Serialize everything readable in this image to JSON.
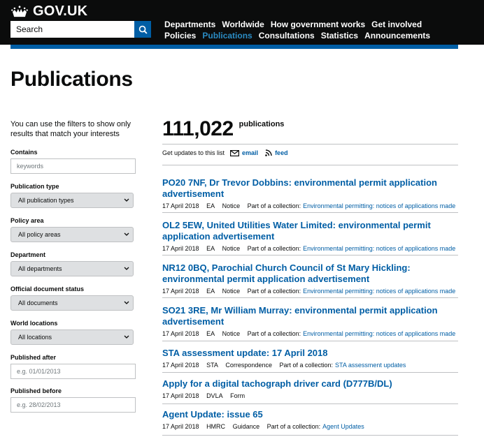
{
  "header": {
    "logo_text": "GOV.UK",
    "search_placeholder": "Search",
    "nav_row1": [
      "Departments",
      "Worldwide",
      "How government works",
      "Get involved"
    ],
    "nav_row2": [
      "Policies",
      "Publications",
      "Consultations",
      "Statistics",
      "Announcements"
    ],
    "active_nav": "Publications"
  },
  "page_title": "Publications",
  "sidebar": {
    "intro": "You can use the filters to show only results that match your interests",
    "contains_label": "Contains",
    "contains_placeholder": "keywords",
    "publication_type_label": "Publication type",
    "publication_type_value": "All publication types",
    "policy_area_label": "Policy area",
    "policy_area_value": "All policy areas",
    "department_label": "Department",
    "department_value": "All departments",
    "official_status_label": "Official document status",
    "official_status_value": "All documents",
    "world_locations_label": "World locations",
    "world_locations_value": "All locations",
    "published_after_label": "Published after",
    "published_after_placeholder": "e.g. 01/01/2013",
    "published_before_label": "Published before",
    "published_before_placeholder": "e.g. 28/02/2013"
  },
  "main": {
    "count": "111,022",
    "count_label": "publications",
    "updates_text": "Get updates to this list",
    "email_label": "email",
    "feed_label": "feed",
    "collection_prefix": "Part of a collection:",
    "results": [
      {
        "title": "PO20 7NF, Dr Trevor Dobbins: environmental permit application advertisement",
        "date": "17 April 2018",
        "org": "EA",
        "type": "Notice",
        "collection": "Environmental permitting: notices of applications made"
      },
      {
        "title": "OL2 5EW, United Utilities Water Limited: environmental permit application advertisement",
        "date": "17 April 2018",
        "org": "EA",
        "type": "Notice",
        "collection": "Environmental permitting: notices of applications made"
      },
      {
        "title": "NR12 0BQ, Parochial Church Council of St Mary Hickling: environmental permit application advertisement",
        "date": "17 April 2018",
        "org": "EA",
        "type": "Notice",
        "collection": "Environmental permitting: notices of applications made"
      },
      {
        "title": "SO21 3RE, Mr William Murray: environmental permit application advertisement",
        "date": "17 April 2018",
        "org": "EA",
        "type": "Notice",
        "collection": "Environmental permitting: notices of applications made"
      },
      {
        "title": "STA assessment update: 17 April 2018",
        "date": "17 April 2018",
        "org": "STA",
        "type": "Correspondence",
        "collection": "STA assessment updates"
      },
      {
        "title": "Apply for a digital tachograph driver card (D777B/DL)",
        "date": "17 April 2018",
        "org": "DVLA",
        "type": "Form",
        "collection": ""
      },
      {
        "title": "Agent Update: issue 65",
        "date": "17 April 2018",
        "org": "HMRC",
        "type": "Guidance",
        "collection": "Agent Updates"
      }
    ]
  },
  "colors": {
    "header_bg": "#0b0c0c",
    "brand_blue": "#005ea5",
    "link_blue": "#005ea5",
    "active_nav": "#2b8cc4",
    "divider": "#bfc1c3",
    "select_bg": "#dee0e2"
  }
}
